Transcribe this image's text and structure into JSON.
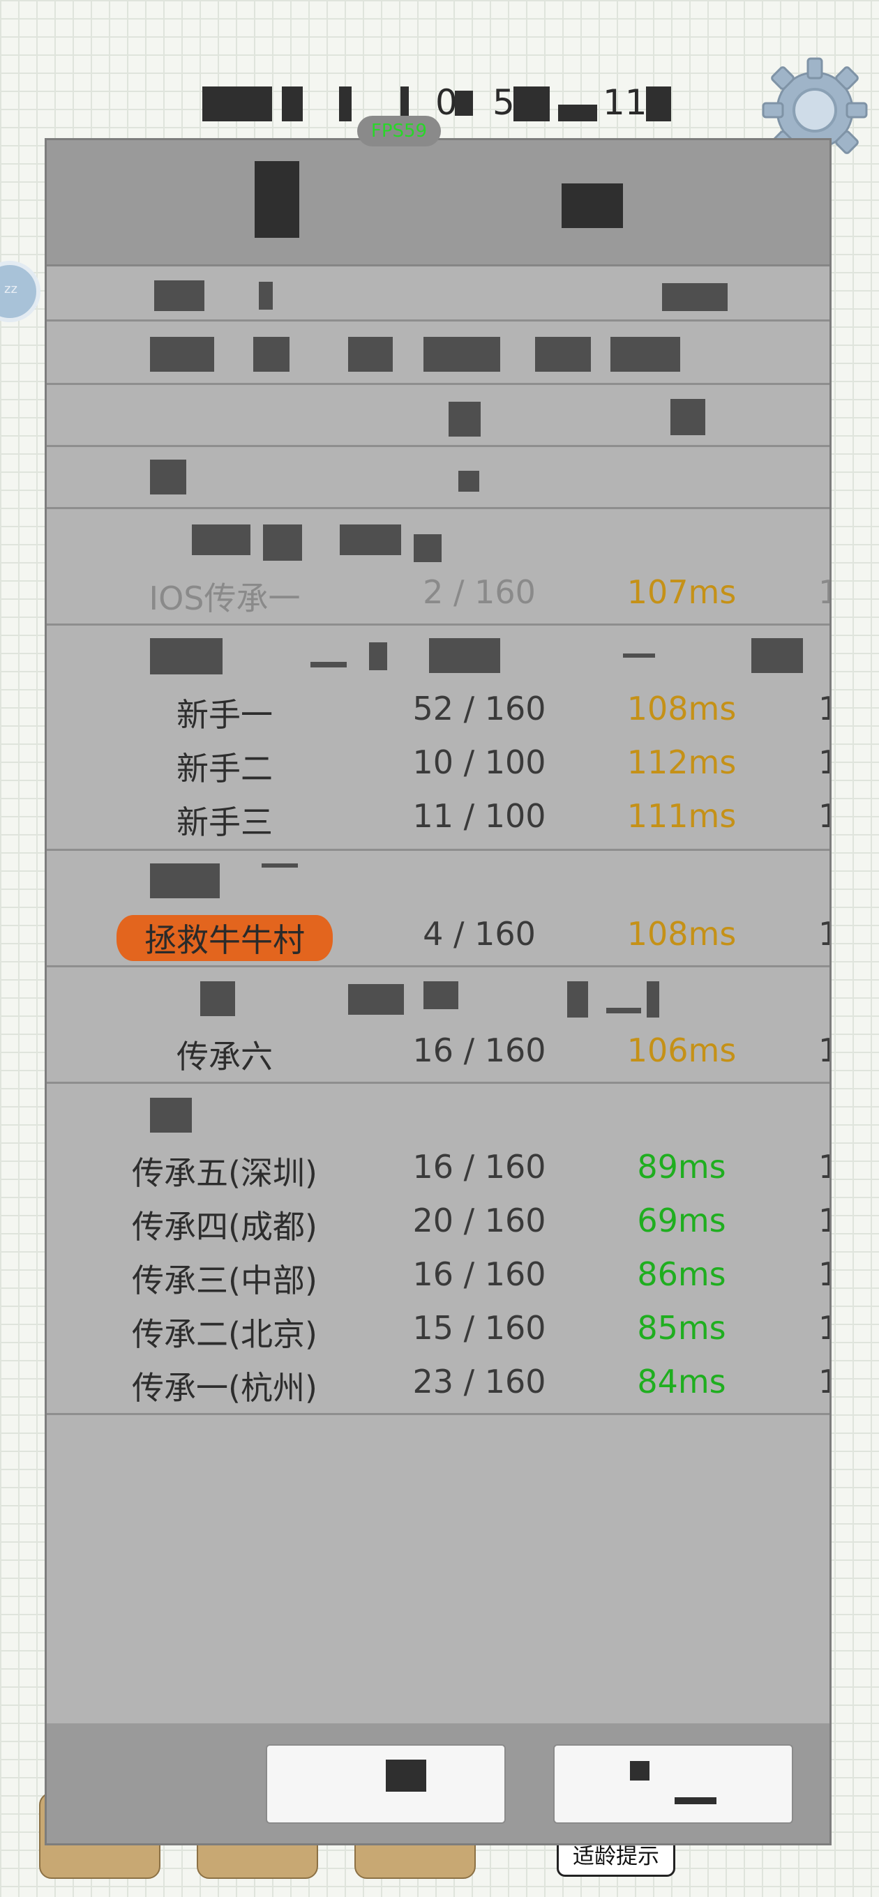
{
  "colors": {
    "ping_good": "#1fae1f",
    "ping_medium": "#c59117",
    "highlight": "#e3651e",
    "fps_text": "#29d629"
  },
  "hud": {
    "fps_label": "FPS59",
    "top_text_fragment_1": "0",
    "top_text_fragment_2": "5",
    "top_text_fragment_3": "11",
    "settings_icon": "gear-icon",
    "age_hint_label": "适龄提示"
  },
  "servers": {
    "ios": [
      {
        "name": "IOS传承一",
        "count": "2 / 160",
        "ping": "107ms",
        "extra": "1"
      }
    ],
    "newbie": [
      {
        "name": "新手一",
        "count": "52 / 160",
        "ping": "108ms",
        "extra": "1"
      },
      {
        "name": "新手二",
        "count": "10 / 100",
        "ping": "112ms",
        "extra": "1"
      },
      {
        "name": "新手三",
        "count": "11 / 100",
        "ping": "111ms",
        "extra": "1"
      }
    ],
    "rescue": [
      {
        "name": "拯救牛牛村",
        "count": "4 / 160",
        "ping": "108ms",
        "extra": "1"
      }
    ],
    "legacy6": [
      {
        "name": "传承六",
        "count": "16 / 160",
        "ping": "106ms",
        "extra": "1"
      }
    ],
    "legacy": [
      {
        "name": "传承五(深圳)",
        "count": "16 / 160",
        "ping": "89ms",
        "extra": "1"
      },
      {
        "name": "传承四(成都)",
        "count": "20 / 160",
        "ping": "69ms",
        "extra": "1"
      },
      {
        "name": "传承三(中部)",
        "count": "16 / 160",
        "ping": "86ms",
        "extra": "1"
      },
      {
        "name": "传承二(北京)",
        "count": "15 / 160",
        "ping": "85ms",
        "extra": "1"
      },
      {
        "name": "传承一(杭州)",
        "count": "23 / 160",
        "ping": "84ms",
        "extra": "1"
      }
    ]
  }
}
